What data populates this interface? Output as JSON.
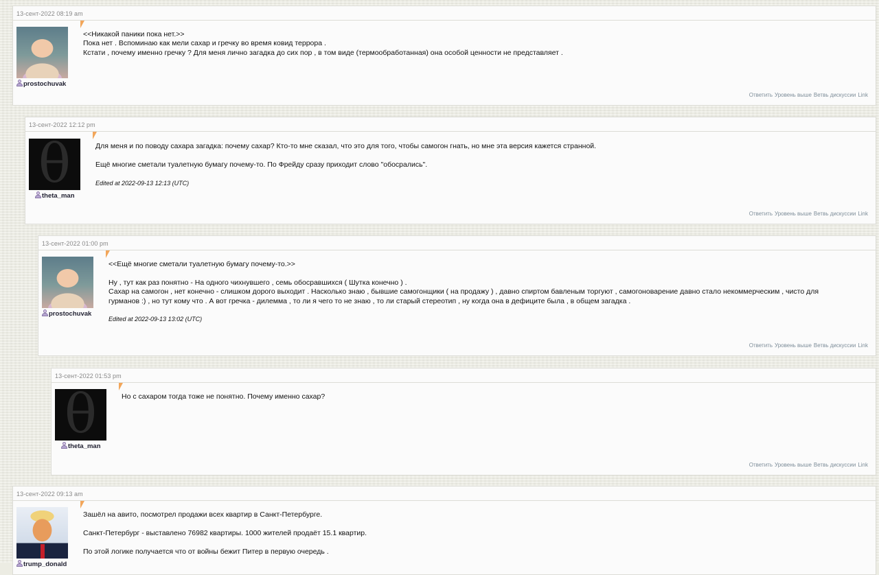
{
  "action_labels": [
    "Ответить",
    "Уровень выше",
    "Ветвь дискуссии",
    "Link"
  ],
  "colors": {
    "page_bg": "#ecece3",
    "comment_bg": "#fbfbfb",
    "accent_arrow": "#f2a65a",
    "action_link": "#7d8d99"
  },
  "comments": [
    {
      "date": "13-сент-2022 08:19 am",
      "username": "prostochuvak",
      "avatar": "baby-avatar",
      "lines": [
        "<<Никакой паники пока нет.>>",
        "Пока нет . Вспоминаю как мели сахар и гречку во время ковид террора .",
        "Кстати , почему именно гречку ? Для меня лично загадка до сих пор , в том виде (термообработанная) она особой ценности не представляет ."
      ],
      "edited": ""
    },
    {
      "date": "13-сент-2022 12:12 pm",
      "username": "theta_man",
      "avatar": "theta-avatar",
      "lines": [
        "Для меня и по поводу сахара загадка: почему сахар? Кто-то мне сказал, что это для того, чтобы самогон гнать, но мне эта версия кажется странной.",
        "",
        "Ещё многие сметали туалетную бумагу почему-то. По Фрейду сразу приходит слово \"обосрались\"."
      ],
      "edited": "Edited at 2022-09-13 12:13 (UTC)"
    },
    {
      "date": "13-сент-2022 01:00 pm",
      "username": "prostochuvak",
      "avatar": "baby-avatar",
      "lines": [
        "<<Ещё многие сметали туалетную бумагу почему-то.>>",
        "",
        "Ну , тут как раз понятно - На одного чихнувшего , семь обосравшихся ( Шутка конечно ) .",
        "Сахар на самогон , нет конечно - слишком дорого выходит . Насколько знаю , бывшие самогонщики ( на продажу ) , давно спиртом бавленым торгуют , самогоноварение давно стало некоммерческим , чисто для",
        "гурманов :) , но тут кому что . А вот гречка - дилемма , то ли я чего то не знаю , то ли старый стереотип , ну когда она в дефиците была , в общем загадка ."
      ],
      "edited": "Edited at 2022-09-13 13:02 (UTC)"
    },
    {
      "date": "13-сент-2022 01:53 pm",
      "username": "theta_man",
      "avatar": "theta-avatar",
      "lines": [
        "Но с сахаром тогда тоже не понятно. Почему именно сахар?"
      ],
      "edited": ""
    },
    {
      "date": "13-сент-2022 09:13 am",
      "username": "trump_donald",
      "avatar": "trump-avatar",
      "lines": [
        "Зашёл на авито, посмотрел продажи всех квартир в Санкт-Петербурге.",
        "",
        "Санкт-Петербург - выставлено 76982 квартиры. 1000 жителей продаёт 15.1 квартир.",
        "",
        "По этой логике получается что от войны бежит Питер в первую очередь ."
      ],
      "edited": ""
    }
  ]
}
